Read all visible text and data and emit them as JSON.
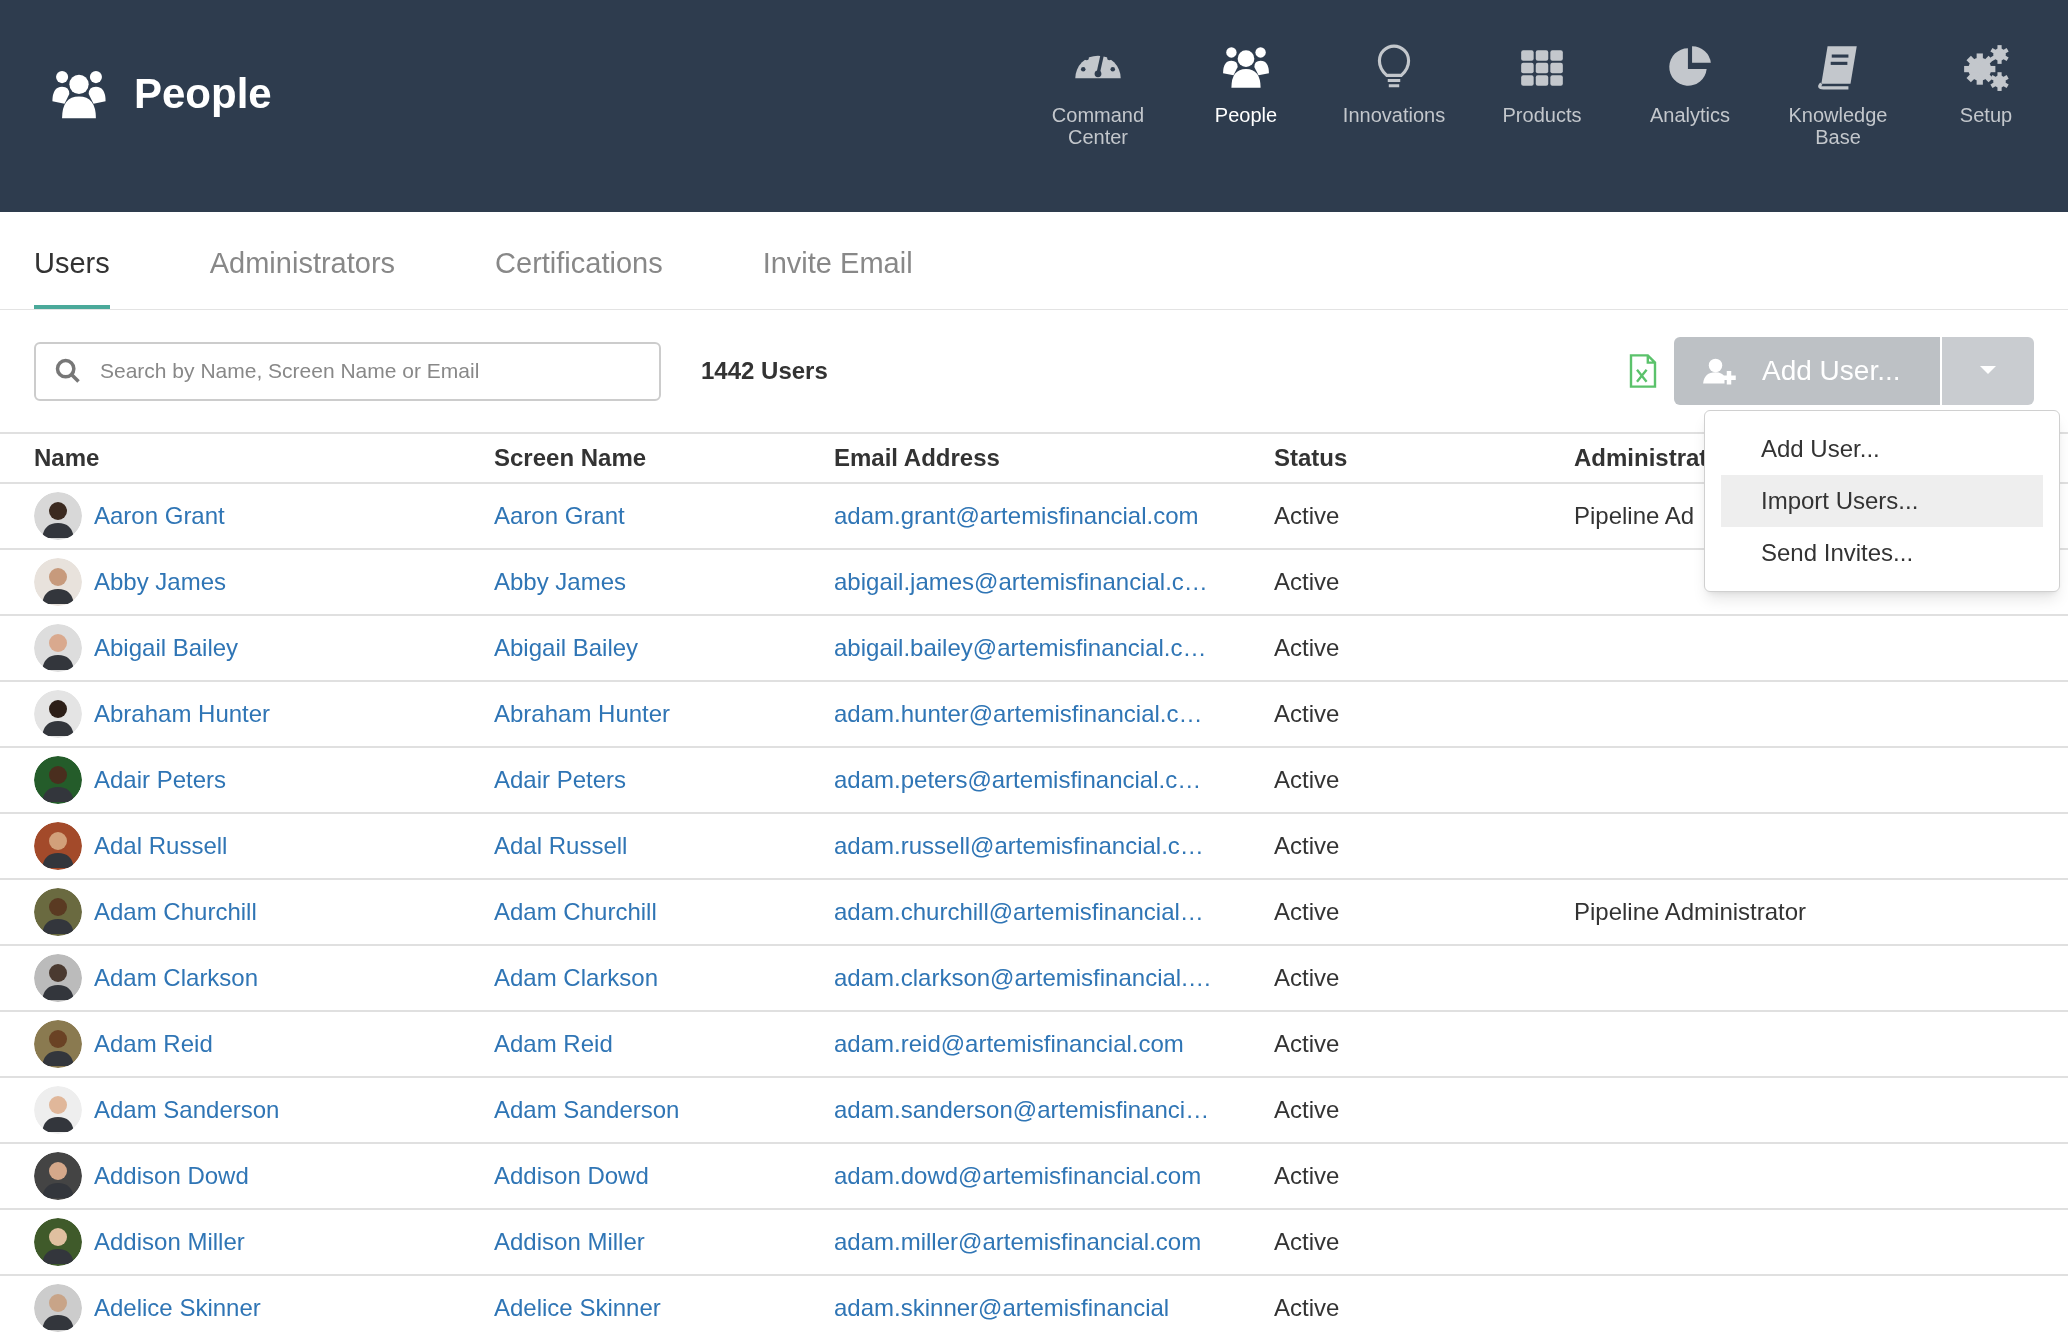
{
  "header": {
    "title": "People"
  },
  "nav": [
    {
      "label": "Command Center",
      "selected": false
    },
    {
      "label": "People",
      "selected": true
    },
    {
      "label": "Innovations",
      "selected": false
    },
    {
      "label": "Products",
      "selected": false
    },
    {
      "label": "Analytics",
      "selected": false
    },
    {
      "label": "Knowledge Base",
      "selected": false
    },
    {
      "label": "Setup",
      "selected": false
    }
  ],
  "tabs": [
    {
      "label": "Users",
      "selected": true
    },
    {
      "label": "Administrators",
      "selected": false
    },
    {
      "label": "Certifications",
      "selected": false
    },
    {
      "label": "Invite Email",
      "selected": false
    }
  ],
  "search": {
    "placeholder": "Search by Name, Screen Name or Email"
  },
  "user_count": "1442 Users",
  "add_button": {
    "label": "Add User..."
  },
  "dropdown": [
    {
      "label": "Add User...",
      "selected": false
    },
    {
      "label": "Import Users...",
      "selected": true
    },
    {
      "label": "Send Invites...",
      "selected": false
    }
  ],
  "table": {
    "columns": [
      "Name",
      "Screen Name",
      "Email Address",
      "Status",
      "Administrat"
    ],
    "rows": [
      {
        "name": "Aaron Grant",
        "screen_name": "Aaron Grant",
        "email": "adam.grant@artemisfinancial.com",
        "status": "Active",
        "admin": "Pipeline Ad"
      },
      {
        "name": "Abby James",
        "screen_name": "Abby James",
        "email": "abigail.james@artemisfinancial.c…",
        "status": "Active"
      },
      {
        "name": "Abigail Bailey",
        "screen_name": "Abigail Bailey",
        "email": "abigail.bailey@artemisfinancial.c…",
        "status": "Active"
      },
      {
        "name": "Abraham Hunter",
        "screen_name": "Abraham Hunter",
        "email": "adam.hunter@artemisfinancial.c…",
        "status": "Active"
      },
      {
        "name": "Adair Peters",
        "screen_name": "Adair Peters",
        "email": "adam.peters@artemisfinancial.c…",
        "status": "Active"
      },
      {
        "name": "Adal Russell",
        "screen_name": "Adal Russell",
        "email": "adam.russell@artemisfinancial.c…",
        "status": "Active"
      },
      {
        "name": "Adam Churchill",
        "screen_name": "Adam Churchill",
        "email": "adam.churchill@artemisfinancial…",
        "status": "Active",
        "admin": "Pipeline Administrator"
      },
      {
        "name": "Adam Clarkson",
        "screen_name": "Adam Clarkson",
        "email": "adam.clarkson@artemisfinancial.…",
        "status": "Active"
      },
      {
        "name": "Adam Reid",
        "screen_name": "Adam Reid",
        "email": "adam.reid@artemisfinancial.com",
        "status": "Active"
      },
      {
        "name": "Adam Sanderson",
        "screen_name": "Adam Sanderson",
        "email": "adam.sanderson@artemisfinanci…",
        "status": "Active"
      },
      {
        "name": "Addison Dowd",
        "screen_name": "Addison Dowd",
        "email": "adam.dowd@artemisfinancial.com",
        "status": "Active"
      },
      {
        "name": "Addison Miller",
        "screen_name": "Addison Miller",
        "email": "adam.miller@artemisfinancial.com",
        "status": "Active"
      },
      {
        "name": "Adelice Skinner",
        "screen_name": "Adelice Skinner",
        "email": "adam.skinner@artemisfinancial",
        "status": "Active"
      }
    ]
  }
}
